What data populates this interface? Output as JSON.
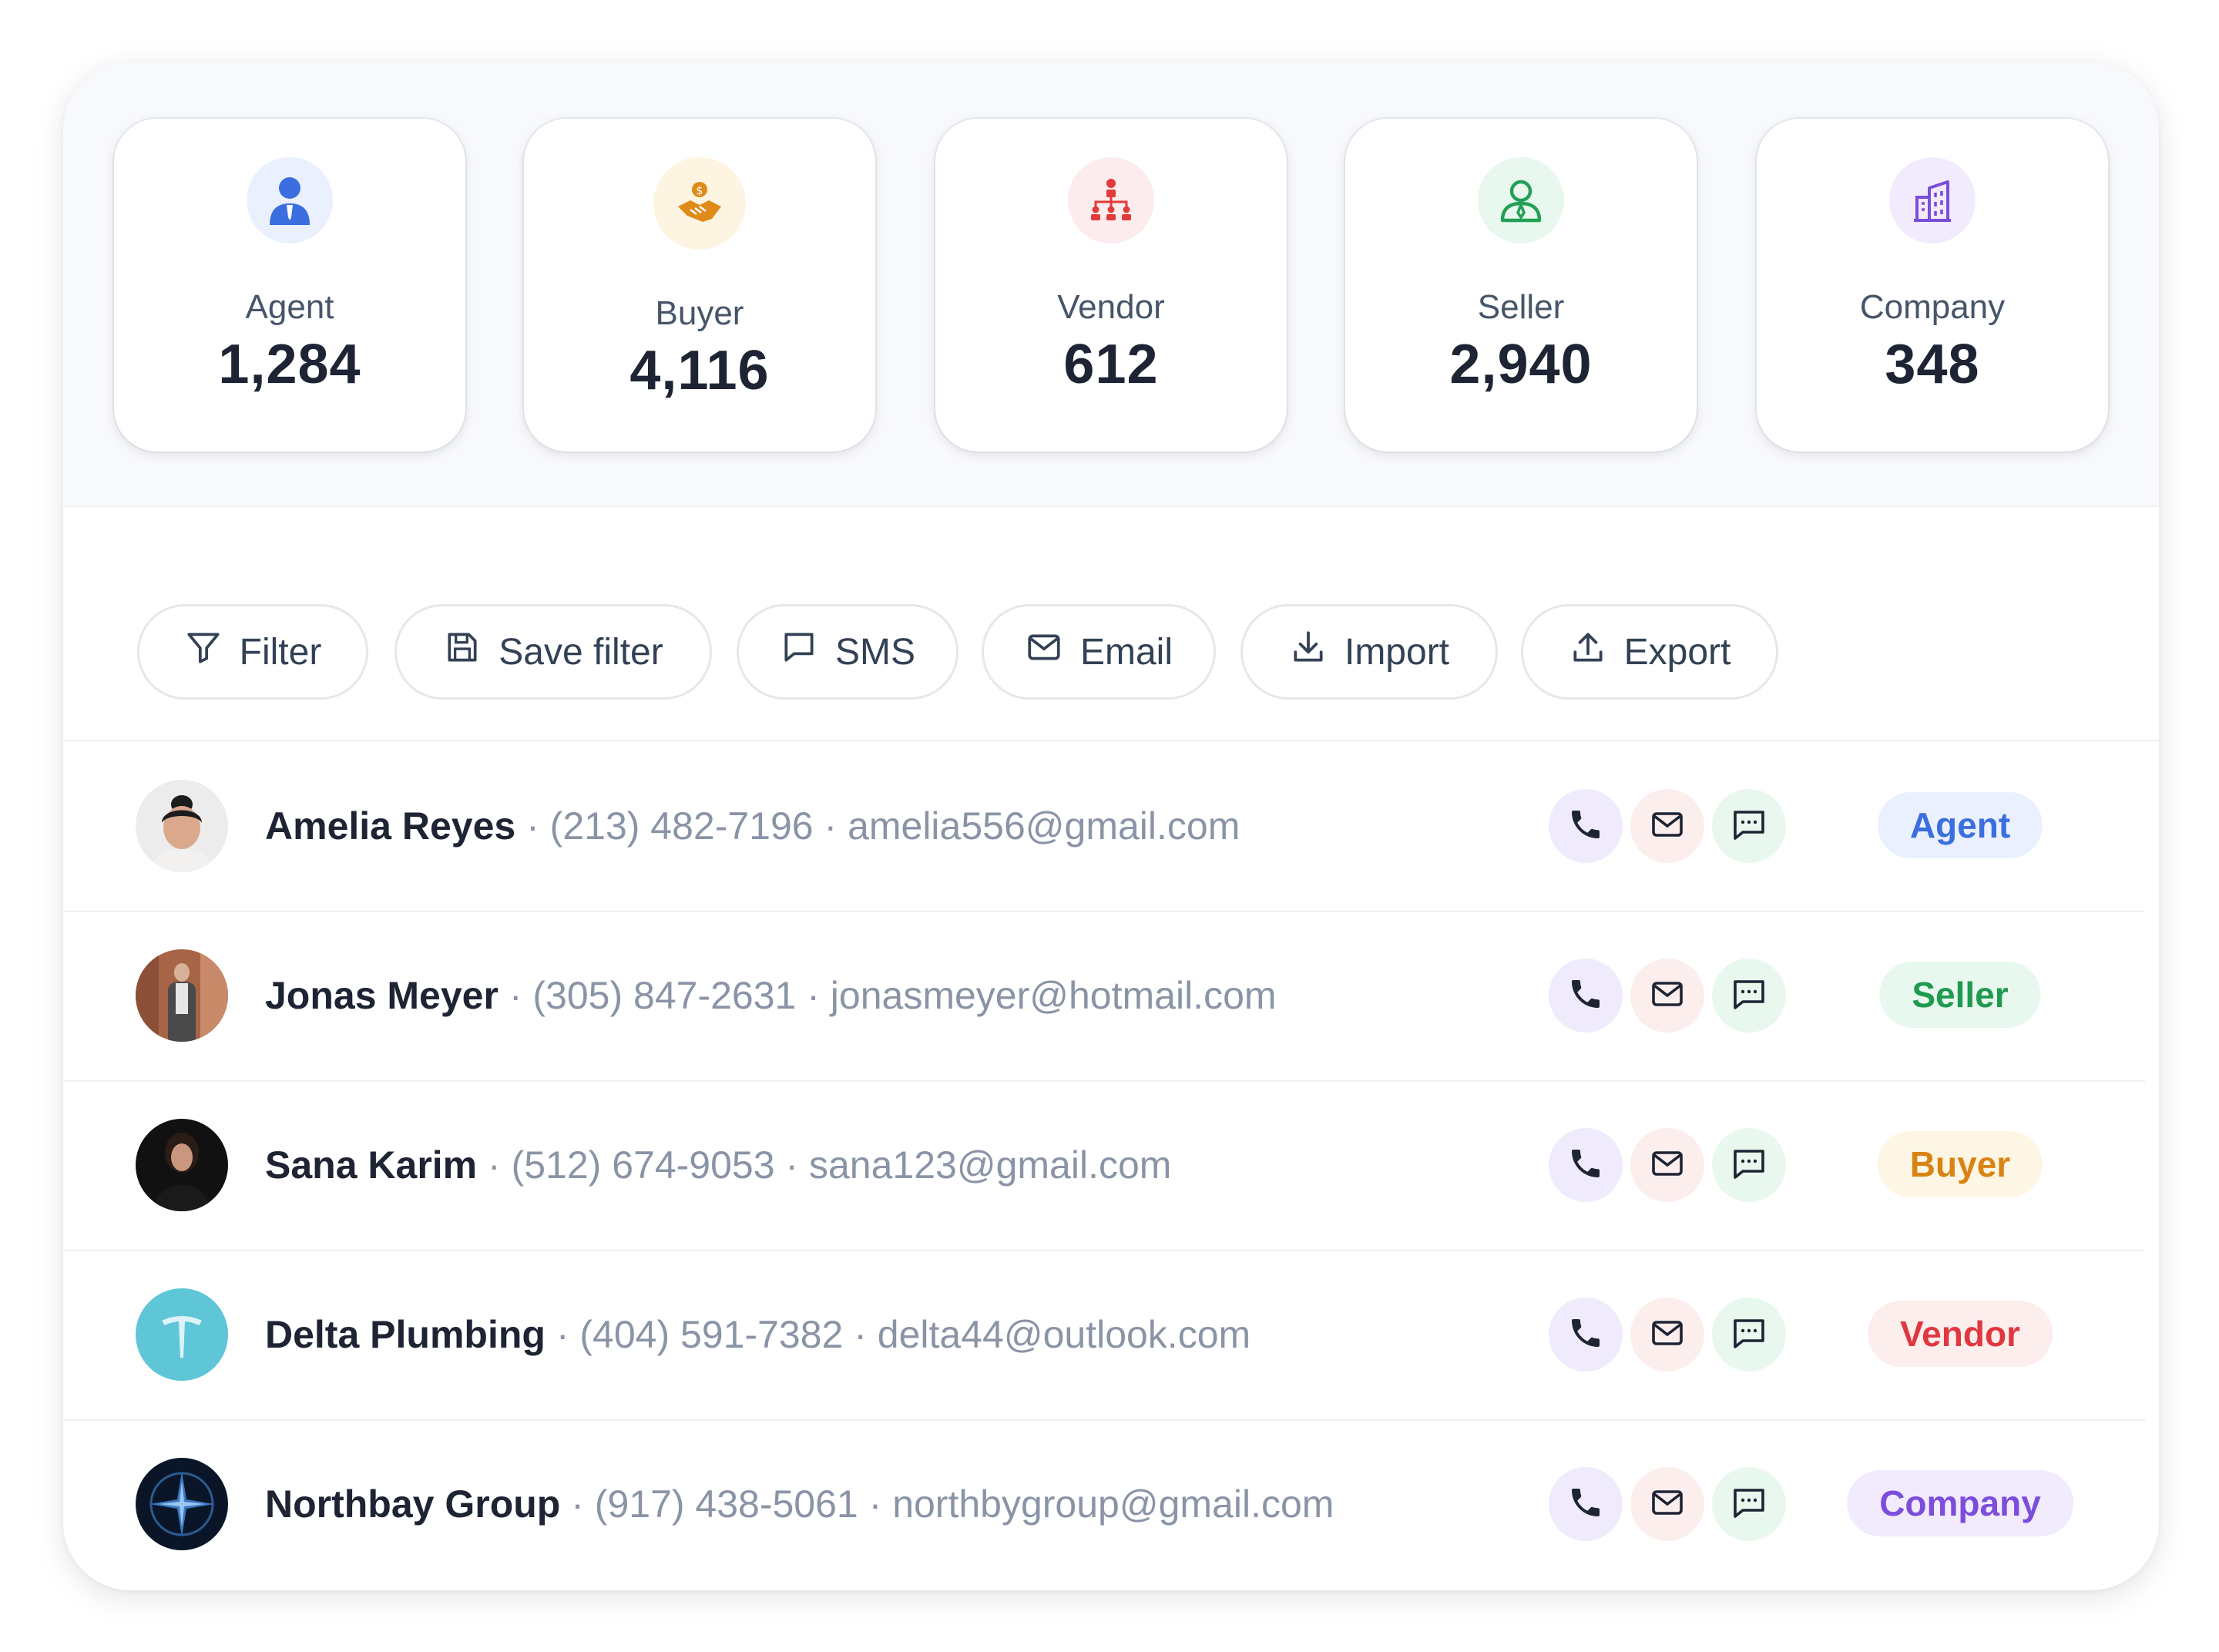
{
  "stats": [
    {
      "label": "Agent",
      "value": "1,284",
      "icon": "agent-icon",
      "color": "#3b6fe0",
      "bg": "#eaf0fd"
    },
    {
      "label": "Buyer",
      "value": "4,116",
      "icon": "handshake-icon",
      "color": "#e08a1a",
      "bg": "#fef4e2"
    },
    {
      "label": "Vendor",
      "value": "612",
      "icon": "hierarchy-icon",
      "color": "#e23b3b",
      "bg": "#fdeced"
    },
    {
      "label": "Seller",
      "value": "2,940",
      "icon": "user-outline-icon",
      "color": "#23a055",
      "bg": "#e8f8ee"
    },
    {
      "label": "Company",
      "value": "348",
      "icon": "building-icon",
      "color": "#7c4ddb",
      "bg": "#f1ebfd"
    }
  ],
  "toolbar": {
    "filter": "Filter",
    "save_filter": "Save filter",
    "sms": "SMS",
    "email": "Email",
    "import": "Import",
    "export": "Export"
  },
  "contacts": [
    {
      "name": "Amelia Reyes",
      "phone": "(213) 482-7196",
      "email": "amelia556@gmail.com",
      "tag": "Agent"
    },
    {
      "name": "Jonas Meyer",
      "phone": "(305) 847-2631",
      "email": "jonasmeyer@hotmail.com",
      "tag": "Seller"
    },
    {
      "name": "Sana Karim",
      "phone": "(512) 674-9053",
      "email": "sana123@gmail.com",
      "tag": "Buyer"
    },
    {
      "name": "Delta Plumbing",
      "phone": "(404) 591-7382",
      "email": "delta44@outlook.com",
      "tag": "Vendor"
    },
    {
      "name": "Northbay Group",
      "phone": "(917) 438-5061",
      "email": "northbygroup@gmail.com",
      "tag": "Company"
    }
  ],
  "separator": "·",
  "tag_colors": {
    "Agent": {
      "fg": "#3b6fe0",
      "bg": "#eaf0fd"
    },
    "Seller": {
      "fg": "#1f9a4f",
      "bg": "#e8f8ee"
    },
    "Buyer": {
      "fg": "#d98312",
      "bg": "#fef6e4"
    },
    "Vendor": {
      "fg": "#e0383f",
      "bg": "#fdeeee"
    },
    "Company": {
      "fg": "#7c4ddb",
      "bg": "#f1ebfd"
    }
  },
  "action_colors": {
    "call_bg": "#f0ebfc",
    "mail_bg": "#fdeeee",
    "chat_bg": "#e9f8ee"
  }
}
